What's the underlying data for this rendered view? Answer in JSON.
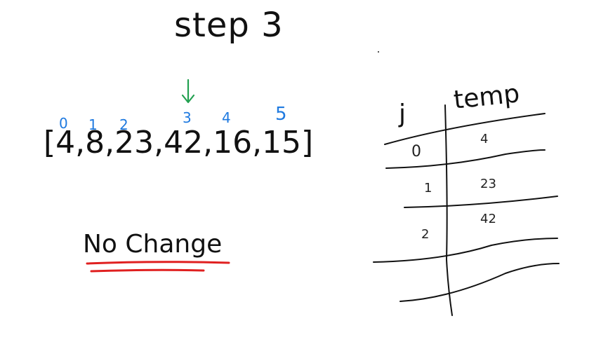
{
  "title": "step 3",
  "array_text": "[4,8,23,42,16,15]",
  "indices": [
    "0",
    "1",
    "2",
    "3",
    "4",
    "5"
  ],
  "pointer_color": "#22a050",
  "index_color": "#1f7ae0",
  "note": "No Change",
  "note_underline_color": "#e02020",
  "table": {
    "headers": [
      "j",
      "temp"
    ],
    "rows": [
      {
        "j": "0",
        "temp": "4"
      },
      {
        "j": "1",
        "temp": "23"
      },
      {
        "j": "2",
        "temp": "42"
      }
    ]
  }
}
